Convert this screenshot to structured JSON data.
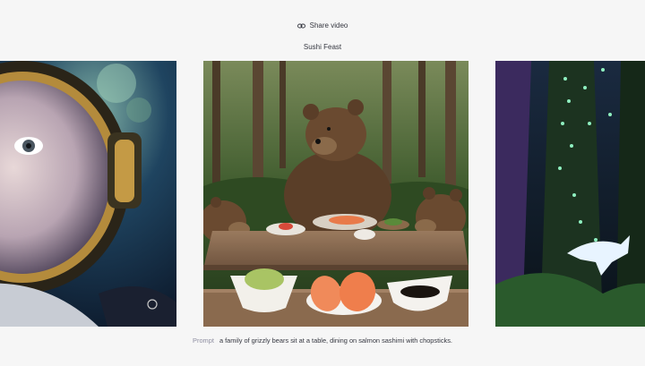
{
  "header": {
    "share_label": "Share video",
    "share_icon": "link-icon",
    "title": "Sushi Feast"
  },
  "carousel": {
    "items": [
      {
        "name": "astronaut-helmet-image",
        "position": "left-partial"
      },
      {
        "name": "grizzly-bears-sushi-image",
        "position": "center",
        "watermark": "logo-icon"
      },
      {
        "name": "glowing-forest-image",
        "position": "right-partial"
      }
    ]
  },
  "caption": {
    "label": "Prompt",
    "text": "a family of grizzly bears sit at a table, dining on salmon sashimi with chopsticks."
  },
  "colors": {
    "background": "#f6f6f6",
    "text": "#353740",
    "muted": "#8e8ea0"
  }
}
